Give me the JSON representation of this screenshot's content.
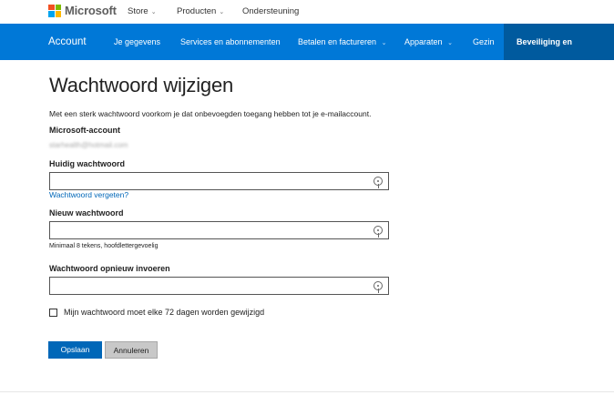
{
  "header": {
    "brand": "Microsoft",
    "nav": [
      {
        "label": "Store",
        "chevron": true
      },
      {
        "label": "Producten",
        "chevron": true
      },
      {
        "label": "Ondersteuning",
        "chevron": false
      }
    ]
  },
  "account_nav": {
    "brand": "Account",
    "items": [
      {
        "label": "Je gegevens"
      },
      {
        "label": "Services en abonnementen"
      },
      {
        "label": "Betalen en factureren"
      },
      {
        "label": "Apparaten"
      },
      {
        "label": "Gezin"
      },
      {
        "label": "Beveiliging en privacy"
      }
    ],
    "chevron_glyph": "⌄"
  },
  "page": {
    "title": "Wachtwoord wijzigen",
    "intro": "Met een sterk wachtwoord voorkom je dat onbevoegden toegang hebben tot je e-mailaccount.",
    "account_label": "Microsoft-account",
    "account_email": "starhealth@hotmail.com"
  },
  "form": {
    "current_label": "Huidig wachtwoord",
    "current_value": "",
    "forgot_link": "Wachtwoord vergeten?",
    "new_label": "Nieuw wachtwoord",
    "new_value": "",
    "new_hint": "Minimaal 8 tekens, hoofdlettergevoelig",
    "repeat_label": "Wachtwoord opnieuw invoeren",
    "repeat_value": "",
    "expire_label": "Mijn wachtwoord moet elke 72 dagen worden gewijzigd",
    "expire_checked": false
  },
  "buttons": {
    "save": "Opslaan",
    "cancel": "Annuleren"
  },
  "colors": {
    "nav_blue": "#0078d7",
    "nav_active": "#005a9e",
    "primary_button": "#0067b8",
    "link": "#0067b8"
  },
  "icons": [
    "microsoft-logo-icon",
    "chevron-down-icon",
    "reveal-password-icon",
    "checkbox-icon"
  ]
}
